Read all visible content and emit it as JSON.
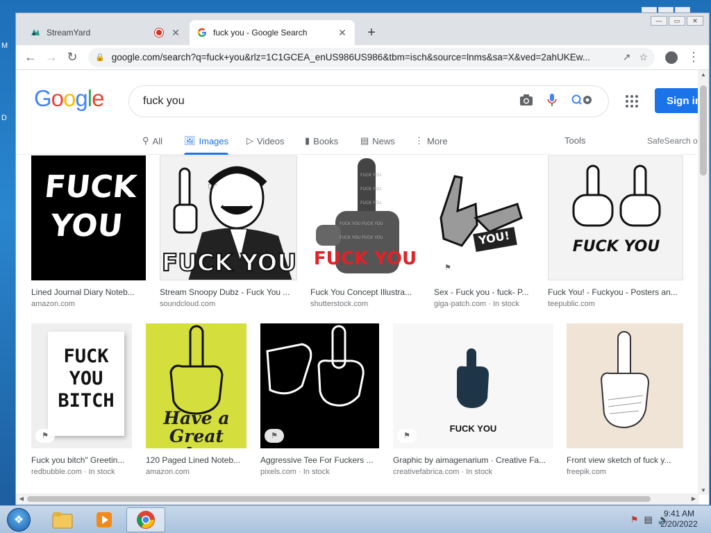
{
  "desktop": {
    "frag_top": "M",
    "frag_mid": "D"
  },
  "browser": {
    "tabs": [
      {
        "title": "StreamYard",
        "recording": true
      },
      {
        "title": "fuck you - Google Search",
        "active": true
      }
    ],
    "url": "google.com/search?q=fuck+you&rlz=1C1GCEA_enUS986US986&tbm=isch&source=lnms&sa=X&ved=2ahUKEw..."
  },
  "google": {
    "logo": [
      "G",
      "o",
      "o",
      "g",
      "l",
      "e"
    ],
    "query": "fuck you",
    "sign_in": "Sign in",
    "nav": [
      {
        "label": "All",
        "icon": "search-icon"
      },
      {
        "label": "Images",
        "icon": "image-icon",
        "active": true
      },
      {
        "label": "Videos",
        "icon": "video-icon"
      },
      {
        "label": "Books",
        "icon": "book-icon"
      },
      {
        "label": "News",
        "icon": "news-icon"
      },
      {
        "label": "More",
        "icon": "more-icon"
      }
    ],
    "tools": "Tools",
    "safesearch": "SafeSearch o"
  },
  "results": [
    {
      "caption": "Lined Journal Diary Noteb...",
      "source": "amazon.com",
      "thumb_text": "FUCK YOU"
    },
    {
      "caption": "Stream Snoopy Dubz - Fuck You ...",
      "source": "soundcloud.com",
      "thumb_text": "FUCK YOU"
    },
    {
      "caption": "Fuck You Concept Illustra...",
      "source": "shutterstock.com",
      "thumb_text": "FUCK YOU"
    },
    {
      "caption": "Sex - Fuck you - fuck- P...",
      "source": "giga-patch.com",
      "stock": "In stock",
      "thumb_text": "YOU!"
    },
    {
      "caption": "Fuck You! - Fuckyou - Posters an...",
      "source": "teepublic.com",
      "thumb_text": "FUCK YOU"
    },
    {
      "caption": "Fuck you bitch\" Greetin...",
      "source": "redbubble.com",
      "stock": "In stock",
      "thumb_text": "FUCK YOU BITCH"
    },
    {
      "caption": "120 Paged Lined Noteb...",
      "source": "amazon.com",
      "thumb_text": "Have a Great day"
    },
    {
      "caption": "Aggressive Tee For Fuckers ...",
      "source": "pixels.com",
      "stock": "In stock"
    },
    {
      "caption": "Graphic by aimagenarium · Creative Fa...",
      "source": "creativefabrica.com",
      "stock": "In stock",
      "thumb_text": "FUCK YOU"
    },
    {
      "caption": "Front view sketch of fuck y...",
      "source": "freepik.com"
    }
  ],
  "taskbar": {
    "time": "9:41 AM",
    "date": "2/20/2022"
  },
  "colors": {
    "accent": "#1a73e8",
    "rec": "#d93025"
  }
}
